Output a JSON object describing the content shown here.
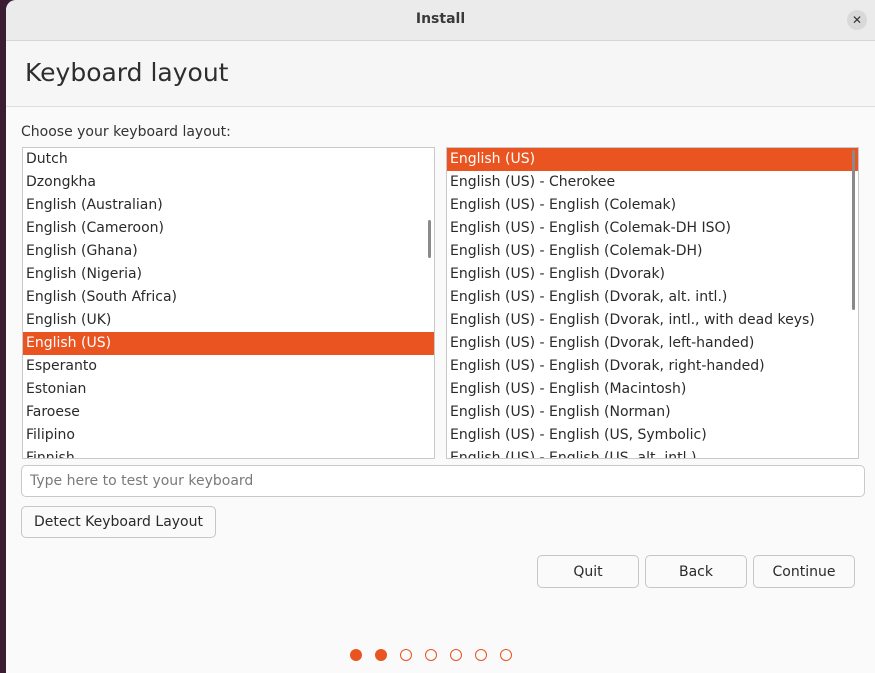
{
  "window": {
    "title": "Install"
  },
  "header": {
    "title": "Keyboard layout"
  },
  "prompt": "Choose your keyboard layout:",
  "layouts": [
    {
      "label": "Dutch"
    },
    {
      "label": "Dzongkha"
    },
    {
      "label": "English (Australian)"
    },
    {
      "label": "English (Cameroon)"
    },
    {
      "label": "English (Ghana)"
    },
    {
      "label": "English (Nigeria)"
    },
    {
      "label": "English (South Africa)"
    },
    {
      "label": "English (UK)"
    },
    {
      "label": "English (US)",
      "selected": true
    },
    {
      "label": "Esperanto"
    },
    {
      "label": "Estonian"
    },
    {
      "label": "Faroese"
    },
    {
      "label": "Filipino"
    },
    {
      "label": "Finnish"
    }
  ],
  "variants": [
    {
      "label": "English (US)",
      "selected": true
    },
    {
      "label": "English (US) - Cherokee"
    },
    {
      "label": "English (US) - English (Colemak)"
    },
    {
      "label": "English (US) - English (Colemak-DH ISO)"
    },
    {
      "label": "English (US) - English (Colemak-DH)"
    },
    {
      "label": "English (US) - English (Dvorak)"
    },
    {
      "label": "English (US) - English (Dvorak, alt. intl.)"
    },
    {
      "label": "English (US) - English (Dvorak, intl., with dead keys)"
    },
    {
      "label": "English (US) - English (Dvorak, left-handed)"
    },
    {
      "label": "English (US) - English (Dvorak, right-handed)"
    },
    {
      "label": "English (US) - English (Macintosh)"
    },
    {
      "label": "English (US) - English (Norman)"
    },
    {
      "label": "English (US) - English (US, Symbolic)"
    },
    {
      "label": "English (US) - English (US, alt. intl.)"
    }
  ],
  "test_input": {
    "placeholder": "Type here to test your keyboard",
    "value": ""
  },
  "buttons": {
    "detect": "Detect Keyboard Layout",
    "quit": "Quit",
    "back": "Back",
    "continue": "Continue"
  },
  "progress": {
    "total_steps": 7,
    "current_step": 2
  },
  "colors": {
    "accent": "#e95420",
    "desktop": "#3b1c33"
  }
}
